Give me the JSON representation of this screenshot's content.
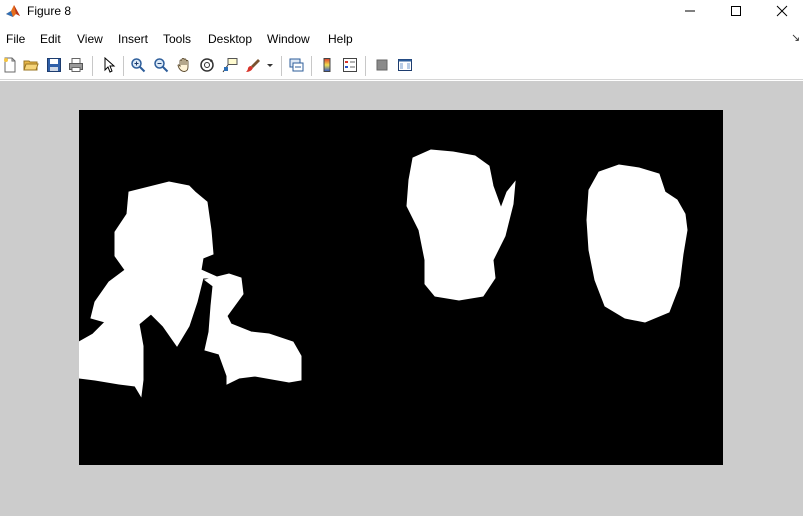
{
  "window": {
    "title": "Figure 8",
    "icons": {
      "app": "matlab-logo-icon",
      "minimize": "minimize-icon",
      "maximize": "maximize-icon",
      "close": "close-icon"
    }
  },
  "menubar": {
    "items": [
      "File",
      "Edit",
      "View",
      "Insert",
      "Tools",
      "Desktop",
      "Window",
      "Help"
    ],
    "overflow_glyph": "↘"
  },
  "toolbar": {
    "buttons": [
      "new-figure-icon",
      "open-file-icon",
      "save-icon",
      "print-icon",
      "select-arrow-icon",
      "zoom-in-icon",
      "zoom-out-icon",
      "pan-hand-icon",
      "rotate-3d-icon",
      "data-cursor-icon",
      "brush-icon",
      "brush-dropdown-icon",
      "link-plot-icon",
      "colorbar-icon",
      "legend-icon",
      "hide-plot-tools-icon",
      "show-plot-tools-icon"
    ]
  },
  "figure": {
    "background": "#cccccc",
    "image_background": "#000000",
    "blob_color": "#ffffff"
  }
}
